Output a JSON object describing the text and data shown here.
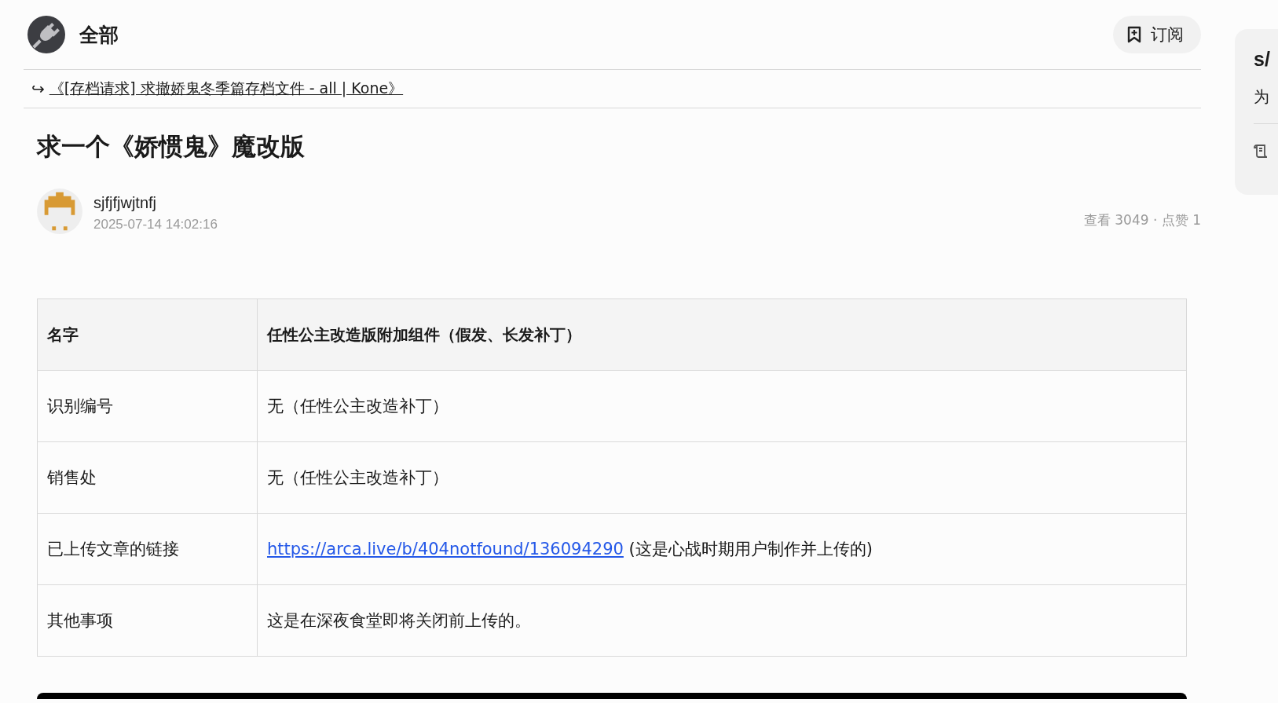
{
  "board": {
    "title": "全部",
    "subscribe_label": "订阅"
  },
  "crosspost": {
    "arrow": "↪",
    "link": "《[存档请求] 求撤娇鬼冬季篇存档文件 - all | Kone》"
  },
  "post": {
    "title": "求一个《娇惯鬼》魔改版",
    "author": "sjfjfjwjtnfj",
    "date": "2025-07-14 14:02:16",
    "stats": "查看 3049 · 点赞 1"
  },
  "table": {
    "rows": [
      {
        "kind": "header",
        "label": "名字",
        "value": "任性公主改造版附加组件（假发、长发补丁）"
      },
      {
        "kind": "text",
        "label": "识别编号",
        "value": "无（任性公主改造补丁）"
      },
      {
        "kind": "text",
        "label": "销售处",
        "value": "无（任性公主改造补丁）"
      },
      {
        "kind": "link",
        "label": "已上传文章的链接",
        "link": "https://arca.live/b/404notfound/136094290",
        "value": "(这是心战时期用户制作并上传的)"
      },
      {
        "kind": "text",
        "label": "其他事项",
        "value": "这是在深夜食堂即将关闭前上传的。"
      }
    ]
  },
  "side_panel": {
    "title": "s/",
    "text": "为"
  }
}
